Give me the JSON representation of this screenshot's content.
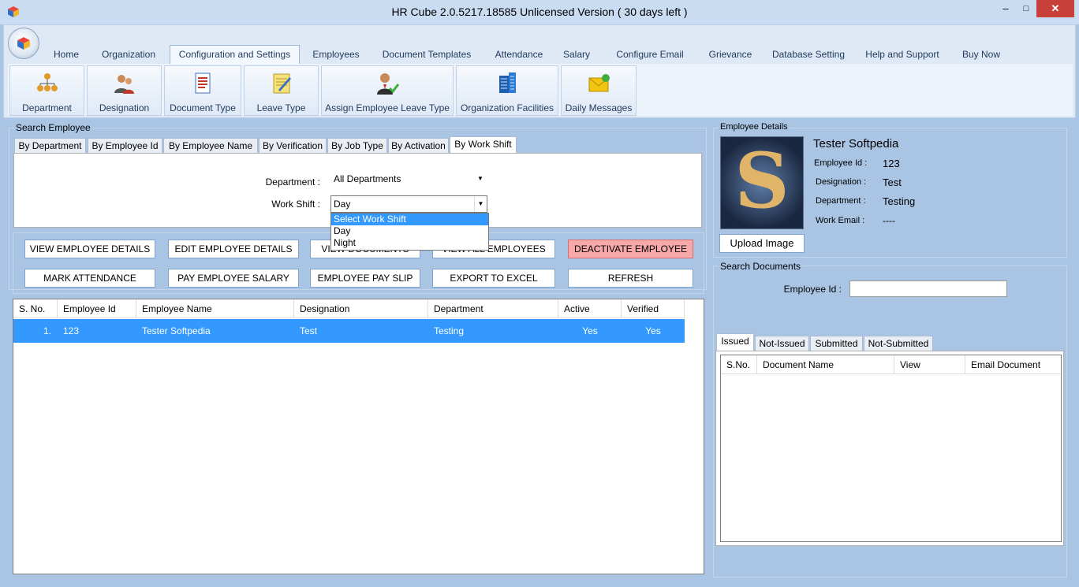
{
  "window": {
    "title": "HR Cube 2.0.5217.18585 Unlicensed Version ( 30 days left )"
  },
  "tabs": [
    "Home",
    "Organization",
    "Configuration and Settings",
    "Employees",
    "Document Templates",
    "Attendance",
    "Salary",
    "Configure Email",
    "Grievance",
    "Database Setting",
    "Help and Support",
    "Buy Now"
  ],
  "ribbon_buttons": [
    "Department",
    "Designation",
    "Document Type",
    "Leave Type",
    "Assign Employee Leave Type",
    "Organization Facilities",
    "Daily Messages"
  ],
  "search": {
    "group_label": "Search Employee",
    "tabs": [
      "By Department",
      "By Employee Id",
      "By Employee Name",
      "By Verification",
      "By Job Type",
      "By Activation",
      "By Work Shift"
    ],
    "department_label": "Department :",
    "department_value": "All Departments",
    "workshift_label": "Work Shift :",
    "workshift_value": "Day",
    "dropdown_options": [
      "Select Work Shift",
      "Day",
      "Night"
    ]
  },
  "actions": {
    "view_details": "VIEW EMPLOYEE DETAILS",
    "edit_details": "EDIT EMPLOYEE DETAILS",
    "view_documents": "VIEW DOCUMENTS",
    "view_all": "VIEW ALL EMPLOYEES",
    "deactivate": "DEACTIVATE EMPLOYEE",
    "mark_attendance": "MARK ATTENDANCE",
    "pay_salary": "PAY EMPLOYEE SALARY",
    "pay_slip": "EMPLOYEE PAY SLIP",
    "export": "EXPORT TO EXCEL",
    "refresh": "REFRESH"
  },
  "table": {
    "headers": [
      "S. No.",
      "Employee Id",
      "Employee Name",
      "Designation",
      "Department",
      "Active",
      "Verified"
    ],
    "rows": [
      [
        "1.",
        "123",
        "Tester  Softpedia",
        "Test",
        "Testing",
        "Yes",
        "Yes"
      ]
    ]
  },
  "employee_details": {
    "group_label": "Employee Details",
    "name": "Tester  Softpedia",
    "employee_id_label": "Employee Id :",
    "employee_id": "123",
    "designation_label": "Designation :",
    "designation": "Test",
    "department_label": "Department :",
    "department": "Testing",
    "email_label": "Work Email :",
    "email": "----",
    "upload_label": "Upload Image"
  },
  "search_documents": {
    "group_label": "Search Documents",
    "employee_id_label": "Employee Id :",
    "tabs": [
      "Issued",
      "Not-Issued",
      "Submitted",
      "Not-Submitted"
    ],
    "headers": [
      "S.No.",
      "Document Name",
      "View",
      "Email Document"
    ]
  },
  "colors": {
    "selection": "#3399ff",
    "deactivate": "#f7a8a8",
    "background": "#aac4e4"
  }
}
